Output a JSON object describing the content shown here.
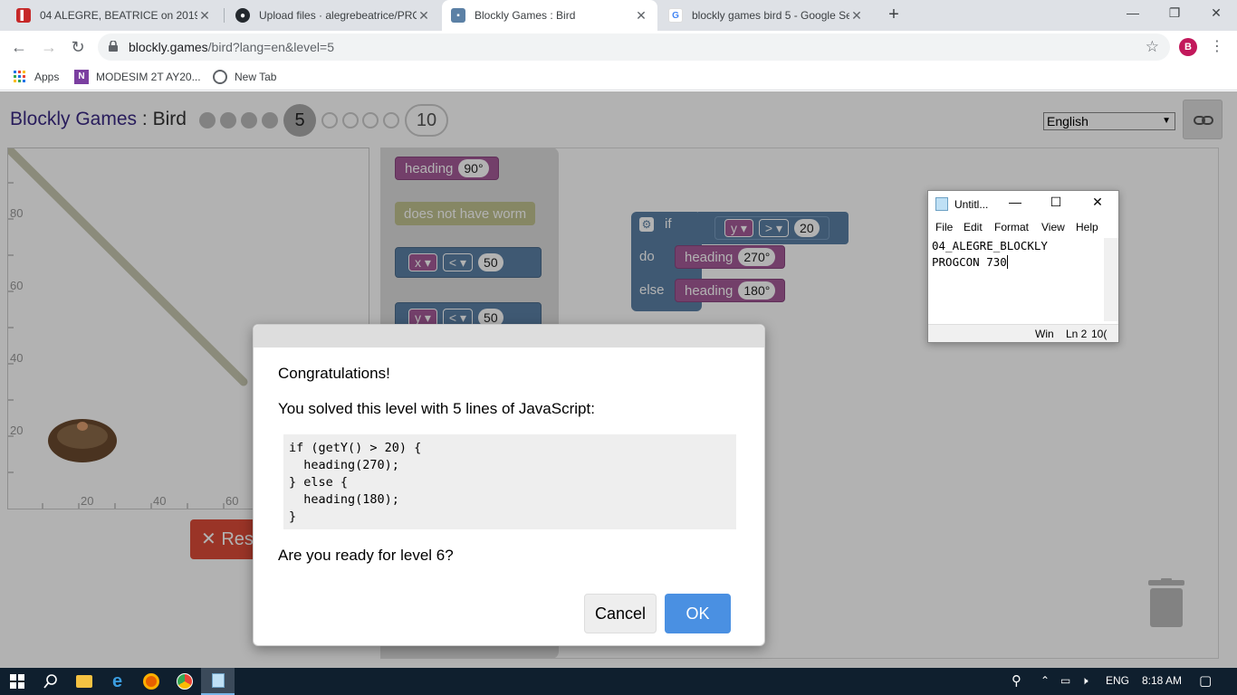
{
  "browser": {
    "tabs": [
      {
        "title": "04 ALEGRE, BEATRICE on 2019T2",
        "active": false
      },
      {
        "title": "Upload files · alegrebeatrice/PRO",
        "active": false
      },
      {
        "title": "Blockly Games : Bird",
        "active": true
      },
      {
        "title": "blockly games bird 5 - Google Se",
        "active": false
      }
    ],
    "url_host": "blockly.games",
    "url_path": "/bird?lang=en&level=5",
    "avatar_letter": "B",
    "bookmarks": [
      "Apps",
      "MODESIM 2T AY20...",
      "New Tab"
    ]
  },
  "page": {
    "app_name": "Blockly Games",
    "separator": " : ",
    "game_name": "Bird",
    "current_level": "5",
    "max_level": "10",
    "language": "English",
    "reset_label": "Res",
    "axis_ticks_y": [
      "80",
      "60",
      "40",
      "20"
    ],
    "axis_ticks_x": [
      "20",
      "40",
      "60"
    ]
  },
  "blocks": {
    "heading_label": "heading",
    "heading_90": "90°",
    "no_worm": "does not have worm",
    "x_var": "x",
    "y_var": "y",
    "lt": "<",
    "gt": ">",
    "fifty": "50",
    "twenty": "20",
    "if_label": "if",
    "do_label": "do",
    "else_label": "else",
    "heading_270": "270°",
    "heading_180": "180°"
  },
  "dialog": {
    "title": "Congratulations!",
    "message": "You solved this level with 5 lines of JavaScript:",
    "code_lines": [
      "if (getY() > 20) {",
      "  heading(270);",
      "} else {",
      "  heading(180);",
      "}"
    ],
    "question": "Are you ready for level 6?",
    "cancel_label": "Cancel",
    "ok_label": "OK"
  },
  "notepad": {
    "title": "Untitl...",
    "menu": [
      "File",
      "Edit",
      "Format",
      "View",
      "Help"
    ],
    "line1": "04_ALEGRE_BLOCKLY",
    "line2": "PROGCON 730",
    "status_enc": "Win",
    "status_pos": "Ln 2",
    "status_zoom": "10("
  },
  "taskbar": {
    "lang": "ENG",
    "time": "8:18 AM"
  },
  "colors": {
    "app_accent": "#3b2a85",
    "ok_button": "#4a90e2",
    "reset_button": "#dd4b39",
    "motion_block": "#a55b99",
    "logic_block": "#5b80a5"
  }
}
